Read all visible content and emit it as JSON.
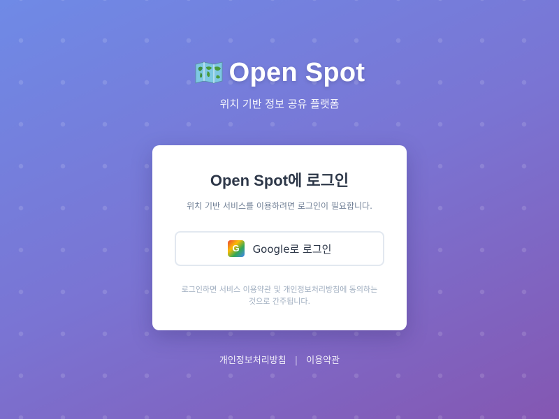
{
  "brand": {
    "icon": "world-map-icon",
    "title": "Open Spot",
    "subtitle": "위치 기반 정보 공유 플랫폼"
  },
  "login_card": {
    "title": "Open Spot에 로그인",
    "description": "위치 기반 서비스를 이용하려면 로그인이 필요합니다.",
    "google_button": {
      "icon": "google-icon",
      "icon_letter": "G",
      "label": "Google로 로그인"
    },
    "terms_line1": "로그인하면 서비스 이용약관 및 개인정보처리방침에 동의하는",
    "terms_line2": "것으로 간주됩니다."
  },
  "footer": {
    "privacy_link": "개인정보처리방침",
    "separator": "|",
    "terms_link": "이용약관"
  },
  "colors": {
    "background_start": "#6f8ae6",
    "background_end": "#8457b2",
    "card": "#ffffff",
    "heading_text": "#2d3748",
    "muted_text": "#718096",
    "button_border": "#e2e8f0"
  }
}
